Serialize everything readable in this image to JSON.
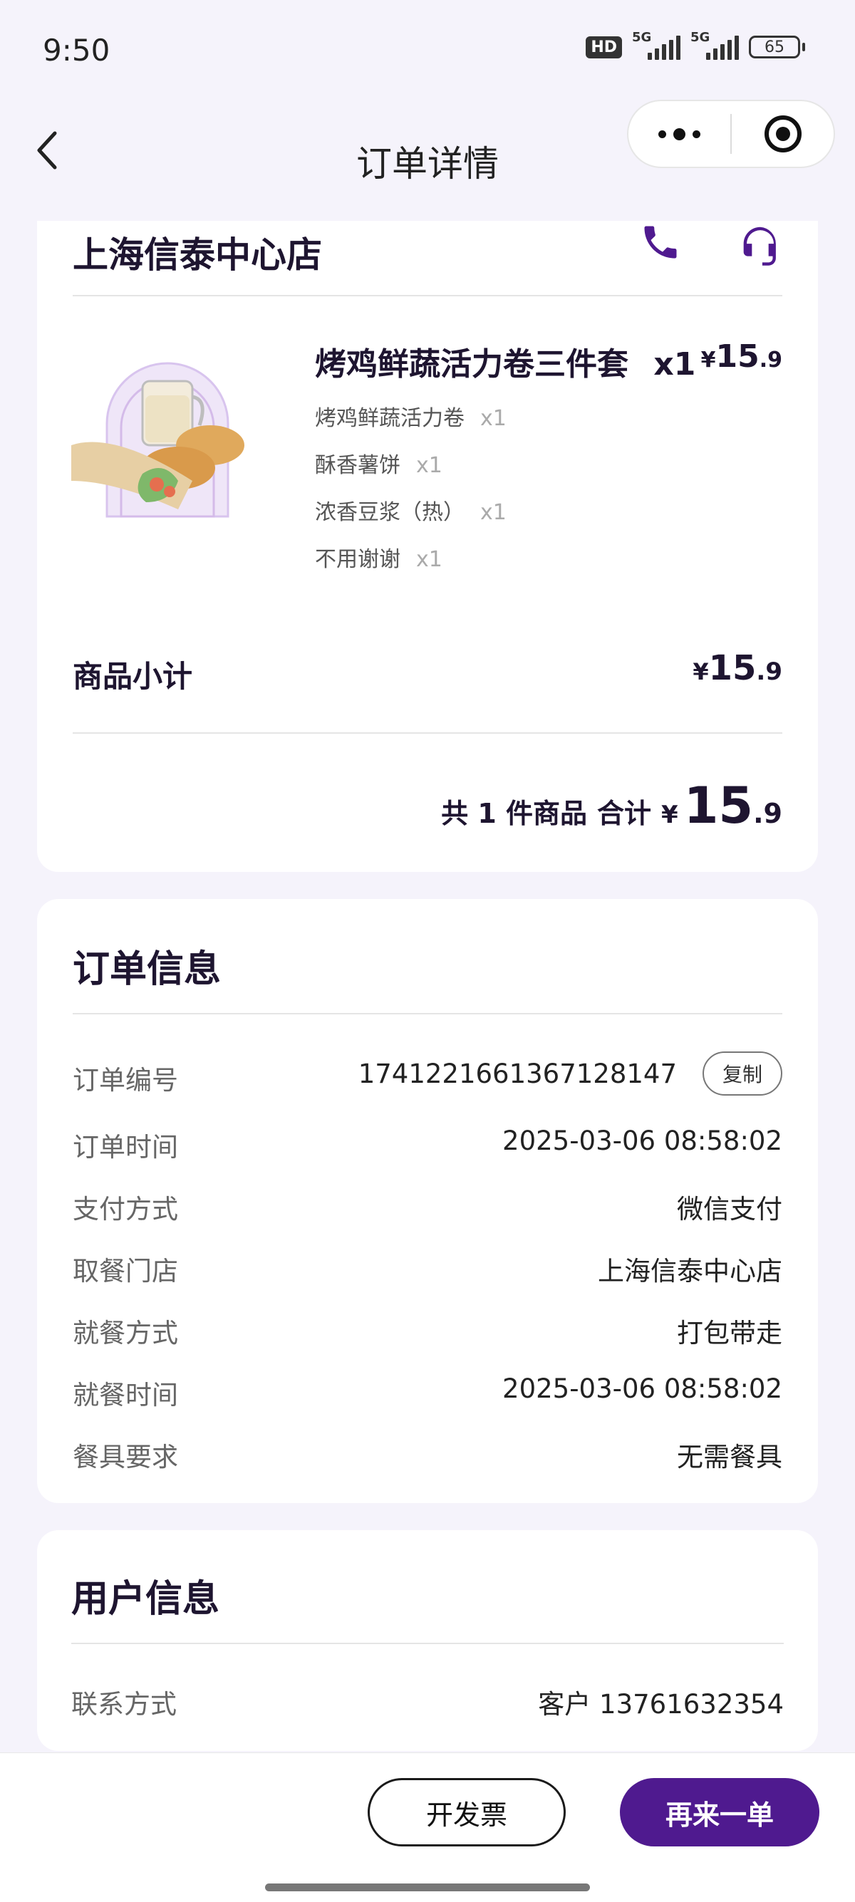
{
  "status_bar": {
    "time": "9:50",
    "hd": "HD",
    "net1": "5G",
    "net2": "5G",
    "battery": "65"
  },
  "nav": {
    "title": "订单详情",
    "back_icon": "chevron-left-icon",
    "more_icon": "more-dots-icon",
    "close_icon": "target-icon"
  },
  "store_card": {
    "store_name": "上海信泰中心店",
    "phone_icon": "phone-icon",
    "support_icon": "headset-icon",
    "product": {
      "name": "烤鸡鲜蔬活力卷三件套",
      "qty": "x1",
      "price_cur": "¥",
      "price_int": "15",
      "price_dec": ".9",
      "items": [
        {
          "name": "烤鸡鲜蔬活力卷",
          "qty": "x1"
        },
        {
          "name": "酥香薯饼",
          "qty": "x1"
        },
        {
          "name": "浓香豆浆（热）",
          "qty": "x1"
        },
        {
          "name": "不用谢谢",
          "qty": "x1"
        }
      ]
    },
    "subtotal_label": "商品小计",
    "subtotal_cur": "¥",
    "subtotal_int": "15",
    "subtotal_dec": ".9",
    "count_text": "共 1 件商品",
    "total_label": "合计",
    "total_cur": "¥",
    "total_int": "15",
    "total_dec": ".9"
  },
  "order_info": {
    "title": "订单信息",
    "copy_label": "复制",
    "rows": [
      {
        "label": "订单编号",
        "value": "1741221661367128147"
      },
      {
        "label": "订单时间",
        "value": "2025-03-06 08:58:02"
      },
      {
        "label": "支付方式",
        "value": "微信支付"
      },
      {
        "label": "取餐门店",
        "value": "上海信泰中心店"
      },
      {
        "label": "就餐方式",
        "value": "打包带走"
      },
      {
        "label": "就餐时间",
        "value": "2025-03-06 08:58:02"
      },
      {
        "label": "餐具要求",
        "value": "无需餐具"
      }
    ]
  },
  "user_info": {
    "title": "用户信息",
    "contact_label": "联系方式",
    "contact_value": "客户 13761632354"
  },
  "actions": {
    "invoice": "开发票",
    "reorder": "再来一单"
  },
  "colors": {
    "accent": "#4f1a8f",
    "background": "#f5f3fb"
  }
}
